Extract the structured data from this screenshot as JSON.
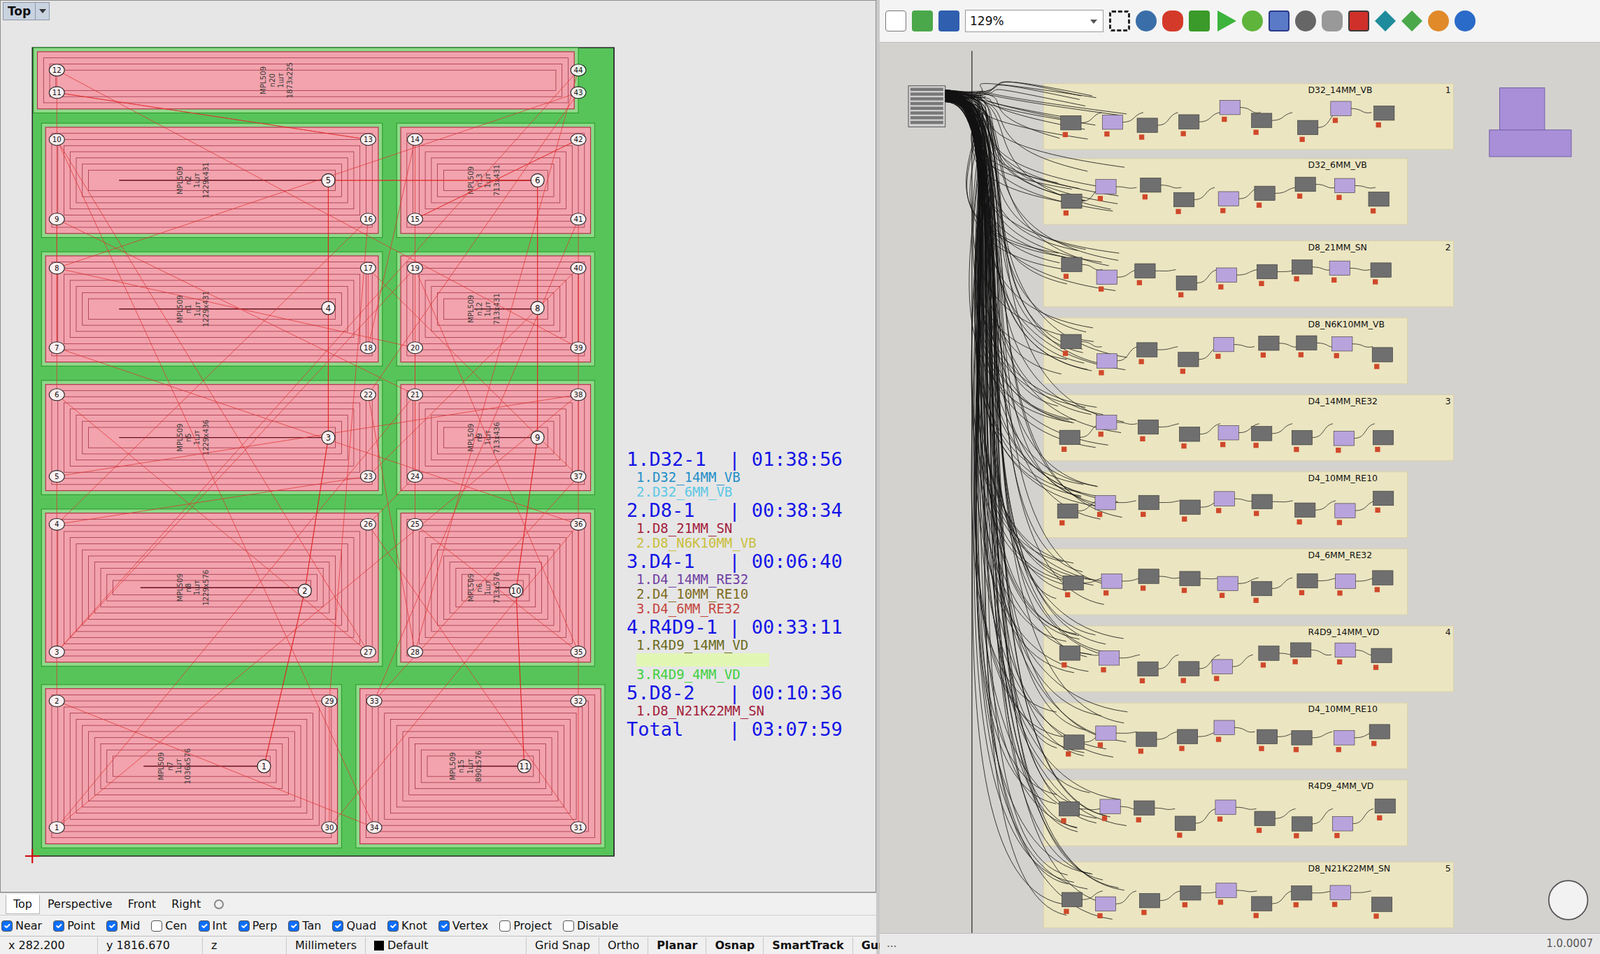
{
  "viewport": {
    "label": "Top"
  },
  "drawing": {
    "panels": [
      {
        "label": [
          "MPL509",
          "n20",
          "1шт",
          "1873x225"
        ]
      },
      {
        "label": [
          "MPL509",
          "n2",
          "1шт",
          "1229x431"
        ],
        "op": "5"
      },
      {
        "label": [
          "MPL509",
          "n13",
          "1шт",
          "713x431"
        ],
        "op": "6"
      },
      {
        "label": [
          "MPL509",
          "n1",
          "1шт",
          "1229x431"
        ],
        "op": "4"
      },
      {
        "label": [
          "MPL509",
          "n12",
          "1шт",
          "713x431"
        ],
        "op": "8"
      },
      {
        "label": [
          "MPL509",
          "n5",
          "1шт",
          "1229x436"
        ],
        "op": "3"
      },
      {
        "label": [
          "MPL509",
          "n9",
          "1шт",
          "713x436"
        ],
        "op": "9"
      },
      {
        "label": [
          "MPL509",
          "n8",
          "1шт",
          "1229x576"
        ],
        "op": "2"
      },
      {
        "label": [
          "MPL509",
          "n6",
          "1шт",
          "713x576"
        ],
        "op": "10"
      },
      {
        "label": [
          "MPL509",
          "n7",
          "1шт",
          "1036x576"
        ],
        "op": "1"
      },
      {
        "label": [
          "MPL509",
          "n15",
          "1шт",
          "890x576"
        ],
        "op": "11"
      }
    ],
    "markers": {
      "left": [
        "12",
        "11",
        "10",
        "9",
        "8",
        "7",
        "6",
        "5",
        "4",
        "3",
        "2",
        "1"
      ],
      "center_left": [
        "13",
        "16",
        "17",
        "18",
        "22",
        "23",
        "26",
        "27",
        "29",
        "30"
      ],
      "center_right": [
        "14",
        "15",
        "19",
        "20",
        "21",
        "24",
        "25",
        "28",
        "33",
        "34"
      ],
      "right": [
        "44",
        "43",
        "42",
        "41",
        "40",
        "39",
        "38",
        "37",
        "36",
        "35",
        "32",
        "31"
      ]
    }
  },
  "legend": {
    "jobs": [
      {
        "heading": "1.D32-1  | 01:38:56",
        "items": [
          {
            "text": "1.D32_14MM_VB",
            "kind": "text",
            "color": "#1f8fc8"
          },
          {
            "text": "2.D32_6MM_VB",
            "kind": "text",
            "color": "#5cc8e6"
          }
        ]
      },
      {
        "heading": "2.D8-1   | 00:38:34",
        "items": [
          {
            "text": "1.D8_21MM_SN",
            "kind": "text",
            "color": "#a3213c"
          },
          {
            "text": "2.D8_N6K10MM_VB",
            "kind": "text",
            "color": "#c9bf3c"
          }
        ]
      },
      {
        "heading": "3.D4-1   | 00:06:40",
        "items": [
          {
            "text": "1.D4_14MM_RE32",
            "kind": "text",
            "color": "#6f3fa3"
          },
          {
            "text": "2.D4_10MM_RE10",
            "kind": "text",
            "color": "#7e6c1e"
          },
          {
            "text": "3.D4_6MM_RE32",
            "kind": "text",
            "color": "#c4463f"
          }
        ]
      },
      {
        "heading": "4.R4D9-1 | 00:33:11",
        "items": [
          {
            "text": "1.R4D9_14MM_VD",
            "kind": "text",
            "color": "#6b6b1e"
          },
          {
            "text": "",
            "kind": "highlight",
            "color": "#e2f6b4"
          },
          {
            "text": "3.R4D9_4MM_VD",
            "kind": "text",
            "color": "#3fd03f"
          }
        ]
      },
      {
        "heading": "5.D8-2   | 00:10:36",
        "items": [
          {
            "text": "1.D8_N21K22MM_SN",
            "kind": "text",
            "color": "#a3213c"
          }
        ]
      }
    ],
    "total": "Total    | 03:07:59"
  },
  "tabs": [
    {
      "label": "Top",
      "selected": true
    },
    {
      "label": "Perspective",
      "selected": false
    },
    {
      "label": "Front",
      "selected": false
    },
    {
      "label": "Right",
      "selected": false
    }
  ],
  "osnap": [
    {
      "label": "Near",
      "checked": true
    },
    {
      "label": "Point",
      "checked": true
    },
    {
      "label": "Mid",
      "checked": true
    },
    {
      "label": "Cen",
      "checked": false
    },
    {
      "label": "Int",
      "checked": true
    },
    {
      "label": "Perp",
      "checked": true
    },
    {
      "label": "Tan",
      "checked": true
    },
    {
      "label": "Quad",
      "checked": true
    },
    {
      "label": "Knot",
      "checked": true
    },
    {
      "label": "Vertex",
      "checked": true
    },
    {
      "label": "Project",
      "checked": false
    },
    {
      "label": "Disable",
      "checked": false
    }
  ],
  "status": {
    "x": "x 282.200",
    "y": "y 1816.670",
    "z": "z",
    "units": "Millimeters",
    "layer": "Default",
    "toggles": [
      {
        "label": "Grid Snap",
        "on": false
      },
      {
        "label": "Ortho",
        "on": false
      },
      {
        "label": "Planar",
        "on": true
      },
      {
        "label": "Osnap",
        "on": true
      },
      {
        "label": "SmartTrack",
        "on": true
      },
      {
        "label": "Gumball",
        "on": true
      }
    ]
  },
  "gh": {
    "zoom": "129%",
    "groups": [
      {
        "title": "D32_14MM_VB",
        "number": "1"
      },
      {
        "title": "D32_6MM_VB"
      },
      {
        "title": "D8_21MM_SN",
        "number": "2"
      },
      {
        "title": "D8_N6K10MM_VB"
      },
      {
        "title": "D4_14MM_RE32",
        "number": "3"
      },
      {
        "title": "D4_10MM_RE10"
      },
      {
        "title": "D4_6MM_RE32"
      },
      {
        "title": "R4D9_14MM_VD",
        "number": "4"
      },
      {
        "title": "D4_10MM_RE10"
      },
      {
        "title": "R4D9_4MM_VD"
      },
      {
        "title": "D8_N21K22MM_SN",
        "number": "5"
      }
    ],
    "footer_left": "...",
    "version": "1.0.0007"
  }
}
